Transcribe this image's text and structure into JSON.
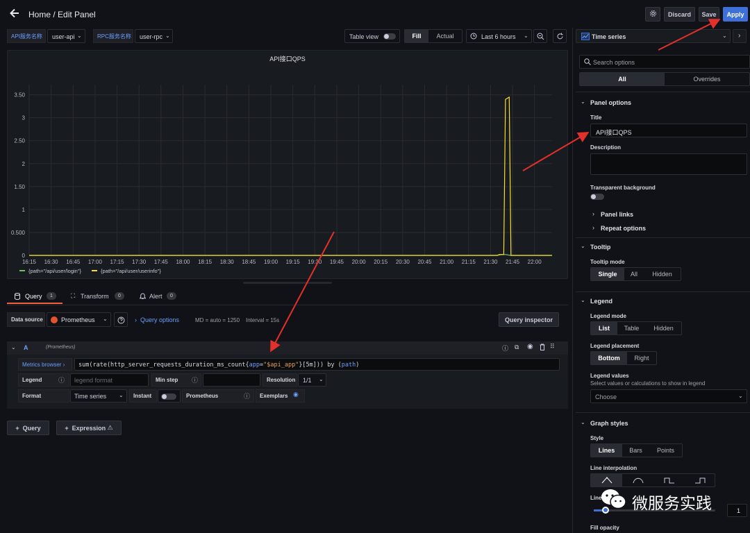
{
  "header": {
    "breadcrumb": "Home / Edit Panel",
    "discard": "Discard",
    "save": "Save",
    "apply": "Apply"
  },
  "vars": [
    {
      "label": "API服务名称",
      "value": "user-api"
    },
    {
      "label": "RPC服务名称",
      "value": "user-rpc"
    }
  ],
  "toolbar": {
    "table_view": "Table view",
    "fill": "Fill",
    "actual": "Actual",
    "time_range": "Last 6 hours"
  },
  "viz_picker": {
    "value": "Time series"
  },
  "chart_data": {
    "type": "line",
    "title": "API接口QPS",
    "x_ticks": [
      "16:15",
      "16:30",
      "16:45",
      "17:00",
      "17:15",
      "17:30",
      "17:45",
      "18:00",
      "18:15",
      "18:30",
      "18:45",
      "19:00",
      "19:15",
      "19:30",
      "19:45",
      "20:00",
      "20:15",
      "20:30",
      "20:45",
      "21:00",
      "21:15",
      "21:30",
      "21:45",
      "22:00"
    ],
    "y_ticks": [
      "0",
      "0.500",
      "1",
      "1.50",
      "2",
      "2.50",
      "3",
      "3.50"
    ],
    "ylim": [
      0,
      3.6
    ],
    "grid": true,
    "legend_placement": "bottom",
    "series": [
      {
        "name": "{path=\"/api/user/login\"}",
        "color": "#73bf69",
        "points": [
          [
            0,
            0
          ],
          [
            21.3,
            0
          ],
          [
            21.5,
            0.02
          ],
          [
            21.7,
            0.02
          ],
          [
            21.9,
            0
          ],
          [
            23.8,
            0
          ]
        ]
      },
      {
        "name": "{path=\"/api/user/userinfo\"}",
        "color": "#fade2a",
        "points": [
          [
            0,
            0
          ],
          [
            21.3,
            0
          ],
          [
            21.4,
            0.02
          ],
          [
            21.6,
            0.02
          ],
          [
            21.68,
            3.4
          ],
          [
            21.85,
            3.45
          ],
          [
            21.93,
            0
          ],
          [
            23.8,
            0
          ]
        ]
      }
    ]
  },
  "query_tabs": [
    {
      "label": "Query",
      "count": "1"
    },
    {
      "label": "Transform",
      "count": "0"
    },
    {
      "label": "Alert",
      "count": "0"
    }
  ],
  "datasource": {
    "label": "Data source",
    "value": "Prometheus",
    "query_options": "Query options",
    "md": "MD = auto = 1250",
    "interval": "Interval = 15s",
    "inspector": "Query inspector"
  },
  "query": {
    "ref": "A",
    "ds": "(Prometheus)",
    "metrics_browser": "Metrics browser",
    "expr_a": "sum(rate(http_server_requests_duration_ms_count{",
    "expr_key": "app",
    "expr_eq": "=",
    "expr_val": "\"$api_app\"",
    "expr_b": "}[5m])) by (",
    "expr_path": "path",
    "expr_c": ")",
    "legend": "Legend",
    "legend_ph": "legend format",
    "min_step": "Min step",
    "resolution": "Resolution",
    "resolution_val": "1/1",
    "format": "Format",
    "format_val": "Time series",
    "instant": "Instant",
    "prometheus": "Prometheus",
    "exemplars": "Exemplars"
  },
  "add_query": "Query",
  "add_expression": "Expression",
  "options": {
    "search_ph": "Search options",
    "tab_all": "All",
    "tab_overrides": "Overrides",
    "panel_options": "Panel options",
    "title_label": "Title",
    "title_value": "API接口QPS",
    "description": "Description",
    "transparent": "Transparent background",
    "panel_links": "Panel links",
    "repeat_options": "Repeat options",
    "tooltip": "Tooltip",
    "tooltip_mode": "Tooltip mode",
    "tooltip_opts": [
      "Single",
      "All",
      "Hidden"
    ],
    "legend": "Legend",
    "legend_mode": "Legend mode",
    "legend_mode_opts": [
      "List",
      "Table",
      "Hidden"
    ],
    "legend_placement": "Legend placement",
    "legend_placement_opts": [
      "Bottom",
      "Right"
    ],
    "legend_values": "Legend values",
    "legend_values_sub": "Select values or calculations to show in legend",
    "legend_values_ph": "Choose",
    "graph_styles": "Graph styles",
    "style": "Style",
    "style_opts": [
      "Lines",
      "Bars",
      "Points"
    ],
    "line_interpolation": "Line interpolation",
    "line_width_short": "Line",
    "line_width_val": "1",
    "fill_opacity": "Fill opacity"
  },
  "watermark": "微服务实践"
}
